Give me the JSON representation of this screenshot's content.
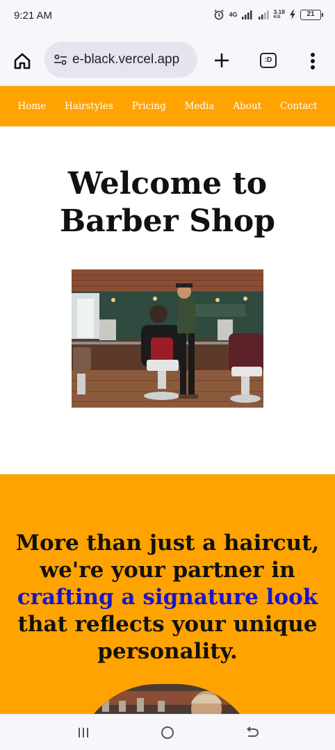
{
  "status_bar": {
    "time": "9:21 AM",
    "network": "4G",
    "speed": "3.18",
    "speed_unit": "K/S",
    "battery": "21"
  },
  "browser": {
    "url": "e-black.vercel.app",
    "tab_label": ":D",
    "icons": [
      "home-icon",
      "site-settings-icon",
      "plus-icon",
      "tabs-icon",
      "more-vert-icon"
    ]
  },
  "nav": {
    "items": [
      {
        "label": "Home"
      },
      {
        "label": "Hairstyles"
      },
      {
        "label": "Pricing"
      },
      {
        "label": "Media"
      },
      {
        "label": "About"
      },
      {
        "label": "Contact"
      }
    ]
  },
  "hero": {
    "title_line1": "Welcome to",
    "title_line2": "Barber Shop"
  },
  "promo": {
    "text_before": "More than just a haircut, we're your partner in",
    "text_highlight": "crafting a signature look",
    "text_after": "that reflects your unique personality."
  },
  "colors": {
    "brand_orange": "#ffa300",
    "accent_blue": "#1a16c8",
    "nav_text": "#ffffff"
  }
}
